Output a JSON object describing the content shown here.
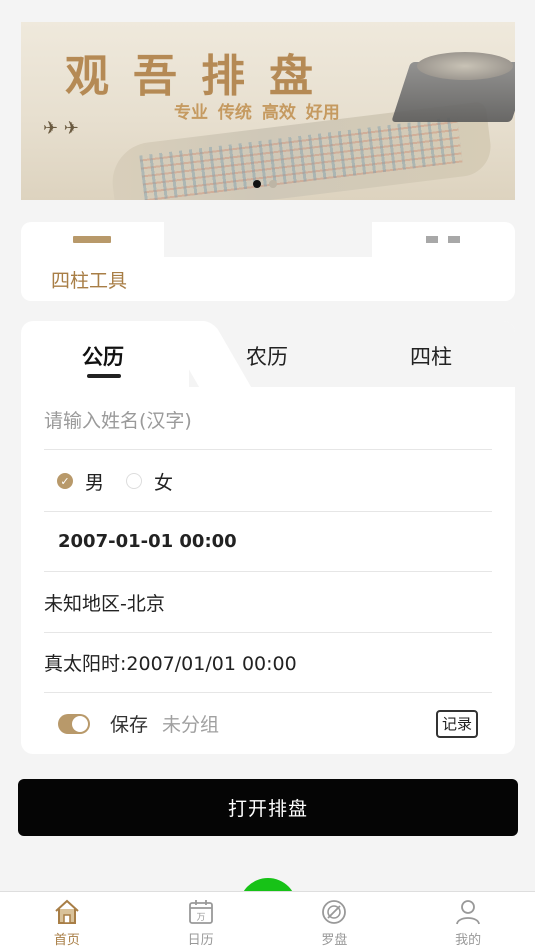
{
  "banner": {
    "title": "观吾排盘",
    "subtitle": "专业 传统  高效  好用",
    "slides": 2,
    "active_slide": 0
  },
  "tool_card": {
    "label": "四柱工具"
  },
  "form": {
    "tabs": [
      {
        "label": "公历",
        "active": true
      },
      {
        "label": "农历",
        "active": false
      },
      {
        "label": "四柱",
        "active": false
      }
    ],
    "name_placeholder": "请输入姓名(汉字)",
    "gender": {
      "male_label": "男",
      "female_label": "女",
      "selected": "男"
    },
    "datetime": "2007-01-01 00:00",
    "location": "未知地区-北京",
    "true_solar_time": "真太阳时:2007/01/01 00:00",
    "save_toggle_on": true,
    "save_label": "保存",
    "group_label": "未分组",
    "record_label": "记录"
  },
  "open_button_label": "打开排盘",
  "bottom_nav": [
    {
      "label": "首页",
      "icon": "home-icon",
      "active": true
    },
    {
      "label": "日历",
      "icon": "calendar-icon",
      "active": false
    },
    {
      "label": "罗盘",
      "icon": "compass-icon",
      "active": false
    },
    {
      "label": "我的",
      "icon": "user-icon",
      "active": false
    }
  ],
  "colors": {
    "accent": "#b8996a",
    "accent_text": "#a87e46",
    "primary_button": "#050505",
    "page_bg": "#f4f4f4"
  }
}
